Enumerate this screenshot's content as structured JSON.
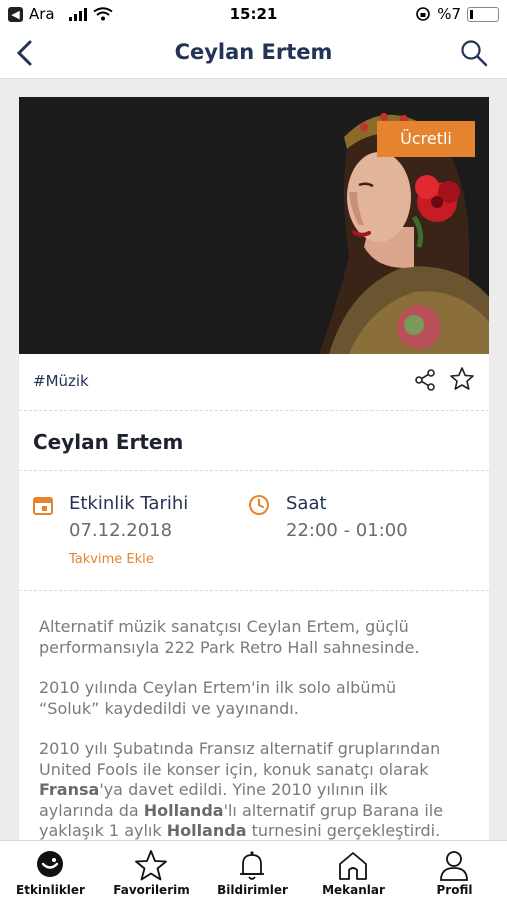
{
  "status_bar": {
    "carrier": "Ara",
    "time": "15:21",
    "battery": "%7"
  },
  "nav": {
    "title": "Ceylan Ertem"
  },
  "event": {
    "badge": "Ücretli",
    "tag": "#Müzik",
    "title": "Ceylan Ertem",
    "date_label": "Etkinlik Tarihi",
    "date_value": "07.12.2018",
    "add_calendar": "Takvime Ekle",
    "time_label": "Saat",
    "time_value": "22:00 - 01:00"
  },
  "description": {
    "p1": "Alternatif müzik sanatçısı Ceylan Ertem, güçlü performansıyla 222 Park Retro Hall sahnesinde.",
    "p2": " 2010 yılında Ceylan Ertem'in ilk solo albümü “Soluk” kaydedildi ve yayınandı.",
    "p3_a": "2010 yılı Şubatında Fransız alternatif gruplarından United Fools ile konser için, konuk sanatçı olarak ",
    "p3_b1": "Fransa",
    "p3_c": "'ya davet edildi. Yine 2010 yılının ilk aylarında da ",
    "p3_b2": "Hollanda",
    "p3_d": "'lı alternatif grup Barana ile yaklaşık 1 aylık ",
    "p3_b3": "Hollanda",
    "p3_e": " turnesini gerçekleştirdi."
  },
  "tabs": [
    {
      "label": "Etkinlikler",
      "icon": "events-icon"
    },
    {
      "label": "Favorilerim",
      "icon": "star-icon"
    },
    {
      "label": "Bildirimler",
      "icon": "bell-icon"
    },
    {
      "label": "Mekanlar",
      "icon": "home-icon"
    },
    {
      "label": "Profil",
      "icon": "person-icon"
    }
  ],
  "colors": {
    "accent": "#e5832f",
    "title": "#233456"
  }
}
